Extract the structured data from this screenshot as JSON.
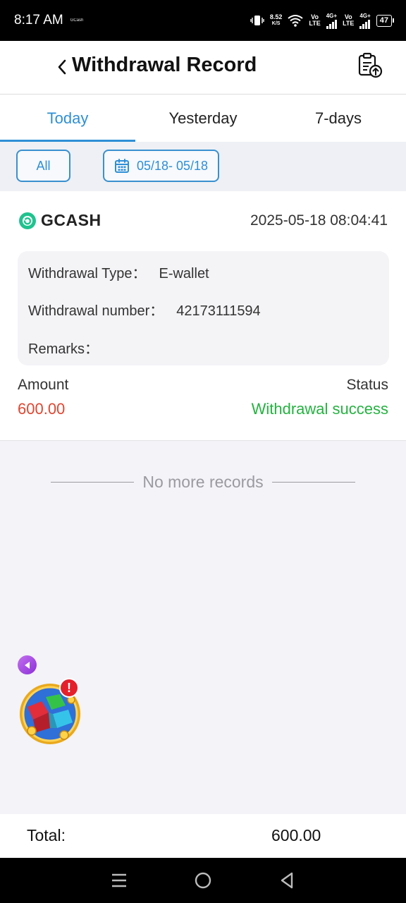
{
  "status_bar": {
    "time": "8:17 AM",
    "carrier": "GCash",
    "speed_value": "8.52",
    "speed_unit": "K/S",
    "net1_top": "Vo",
    "net1_bottom": "LTE",
    "net1_gen": "4G+",
    "net2_top": "Vo",
    "net2_bottom": "LTE",
    "net2_gen": "4G+",
    "battery": "47"
  },
  "header": {
    "title": "Withdrawal Record",
    "back_icon": "chevron-left-icon",
    "action_icon": "clipboard-upload-icon"
  },
  "tabs": [
    {
      "label": "Today",
      "active": true
    },
    {
      "label": "Yesterday",
      "active": false
    },
    {
      "label": "7-days",
      "active": false
    }
  ],
  "filters": {
    "all_label": "All",
    "date_range": "05/18- 05/18",
    "date_icon": "calendar-icon"
  },
  "record": {
    "brand": "GCASH",
    "datetime": "2025-05-18 08:04:41",
    "withdrawal_type_label": "Withdrawal Type：",
    "withdrawal_type_value": "E-wallet",
    "withdrawal_number_label": "Withdrawal number：",
    "withdrawal_number_value": "42173111594",
    "remarks_label": "Remarks：",
    "remarks_value": "",
    "amount_label": "Amount",
    "amount_value": "600.00",
    "status_label": "Status",
    "status_value": "Withdrawal success"
  },
  "list_end_text": "No more records",
  "floating": {
    "badge": "!"
  },
  "total": {
    "label": "Total:",
    "value": "600.00"
  },
  "colors": {
    "accent": "#2e8fd6",
    "amount": "#e2452f",
    "success": "#23b33f",
    "gcash": "#1fc38e"
  }
}
